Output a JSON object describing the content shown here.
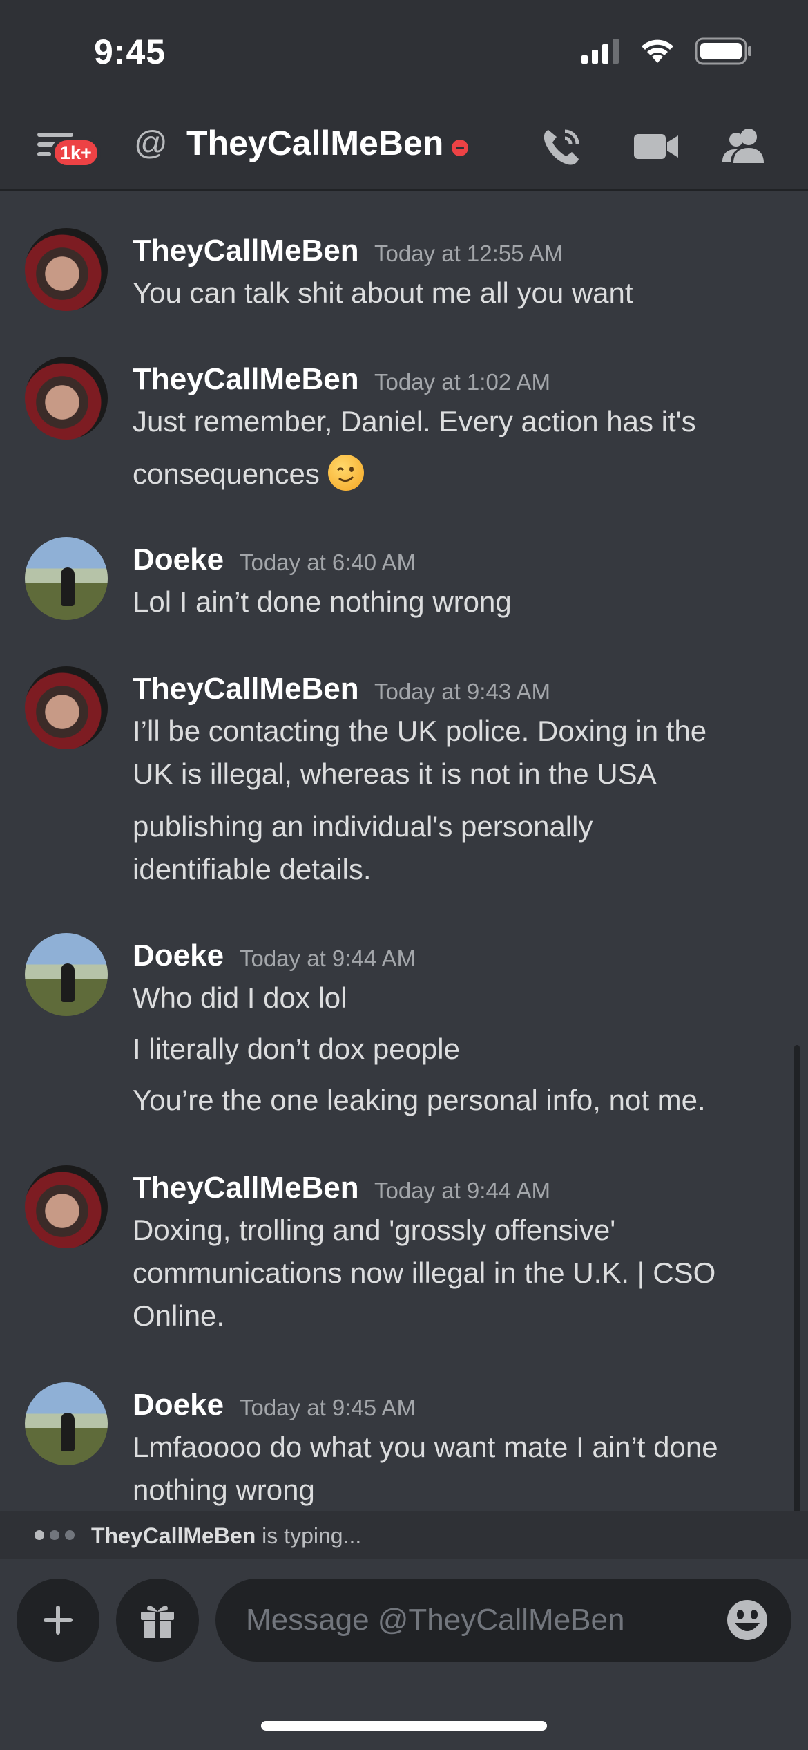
{
  "status_bar": {
    "time": "9:45"
  },
  "header": {
    "badge": "1k+",
    "at_symbol": "@",
    "title": "TheyCallMeBen"
  },
  "messages": [
    {
      "author": "TheyCallMeBen",
      "timestamp": "Today at 12:55 AM",
      "avatar": "ben",
      "lines": [
        "You can talk shit about me all you want"
      ]
    },
    {
      "author": "TheyCallMeBen",
      "timestamp": "Today at 1:02 AM",
      "avatar": "ben",
      "lines": [
        "Just remember, Daniel. Every action has it's",
        "consequences"
      ],
      "emoji": "winking-face"
    },
    {
      "author": "Doeke",
      "timestamp": "Today at 6:40 AM",
      "avatar": "doeke",
      "lines": [
        "Lol I ain’t done nothing wrong"
      ]
    },
    {
      "author": "TheyCallMeBen",
      "timestamp": "Today at 9:43 AM",
      "avatar": "ben",
      "lines": [
        "I’ll be contacting the UK police. Doxing in the",
        "UK is illegal, whereas it is not in the USA",
        "publishing an individual's personally",
        "identifiable details."
      ]
    },
    {
      "author": "Doeke",
      "timestamp": "Today at 9:44 AM",
      "avatar": "doeke",
      "lines": [
        "Who did I dox lol",
        "I literally don’t dox people",
        "You’re the one leaking personal info, not me."
      ]
    },
    {
      "author": "TheyCallMeBen",
      "timestamp": "Today at 9:44 AM",
      "avatar": "ben",
      "lines": [
        "Doxing, trolling and 'grossly offensive'",
        "communications now illegal in the U.K. | CSO",
        "Online."
      ]
    },
    {
      "author": "Doeke",
      "timestamp": "Today at 9:45 AM",
      "avatar": "doeke",
      "lines": [
        "Lmfaoooo do what you want mate I ain’t done",
        "nothing wrong"
      ]
    }
  ],
  "typing": {
    "name": "TheyCallMeBen",
    "suffix": " is typing..."
  },
  "composer": {
    "placeholder": "Message @TheyCallMeBen"
  },
  "colors": {
    "background": "#36393f",
    "header": "#2f3136",
    "badge": "#ed4245",
    "input": "#202225"
  },
  "icons": [
    "menu-icon",
    "at-icon",
    "dnd-status-icon",
    "call-icon",
    "video-icon",
    "members-icon",
    "plus-icon",
    "gift-icon",
    "emoji-icon"
  ]
}
